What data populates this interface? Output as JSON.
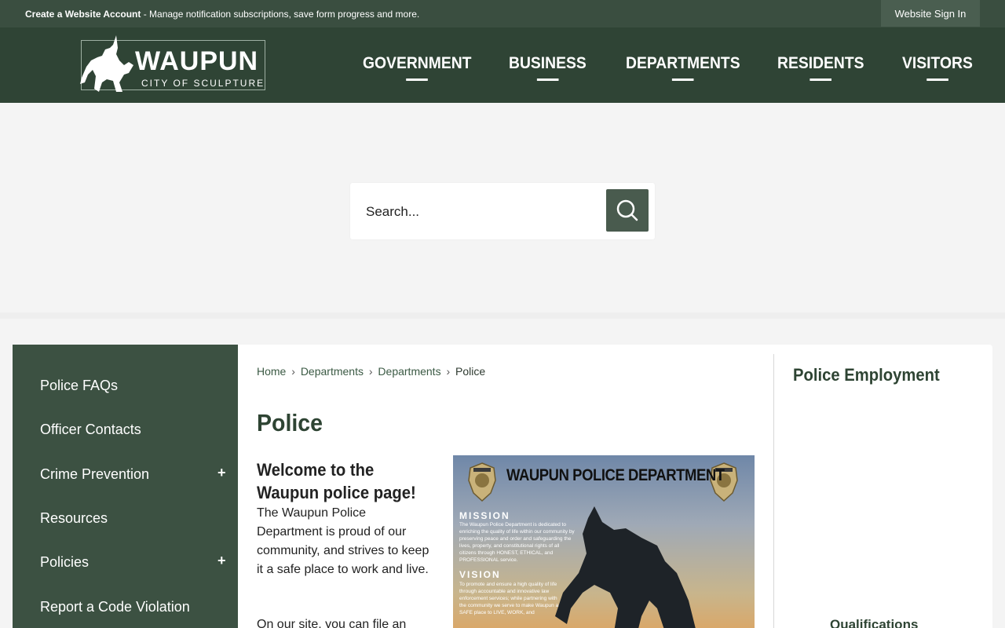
{
  "topbar": {
    "create_account": "Create a Website Account",
    "message": " - Manage notification subscriptions, save form progress and more.",
    "signin": "Website Sign In"
  },
  "logo": {
    "name": "WAUPUN",
    "tagline": "CITY OF SCULPTURE"
  },
  "nav": {
    "items": [
      "GOVERNMENT",
      "BUSINESS",
      "DEPARTMENTS",
      "RESIDENTS",
      "VISITORS"
    ]
  },
  "search": {
    "placeholder": "Search...",
    "icon": "search-icon"
  },
  "sidebar": {
    "items": [
      {
        "label": "Police FAQs"
      },
      {
        "label": "Officer Contacts"
      },
      {
        "label": "Crime Prevention",
        "expand": "+"
      },
      {
        "label": "Resources"
      },
      {
        "label": "Policies",
        "expand": "+"
      },
      {
        "label": "Report a Code Violation"
      }
    ]
  },
  "breadcrumb": {
    "items": [
      "Home",
      "Departments",
      "Departments",
      "Police"
    ],
    "separator": "›"
  },
  "main": {
    "title": "Police",
    "welcome": "Welcome to the Waupun police page!",
    "intro": "The Waupun Police Department is proud of our community, and strives to keep it a safe place to work and live.",
    "intro2": "On our site, you can file an"
  },
  "poster": {
    "title": "WAUPUN POLICE DEPARTMENT",
    "mission_heading": "MISSION",
    "mission_text": "The Waupun Police Department is dedicated to enriching the quality of life within our community by preserving peace and order and safeguarding the lives, property, and constitutional rights of all citizens through HONEST, ETHICAL, and PROFESSIONAL service.",
    "vision_heading": "VISION",
    "vision_text": "To promote and ensure a high quality of life through accountable and innovative law enforcement services; while partnering with the community we serve to make Waupun a SAFE place to LIVE, WORK, and"
  },
  "rightcol": {
    "title": "Police Employment",
    "sub": "Qualifications"
  },
  "colors": {
    "topbar": "#3a4e40",
    "header": "#2f4435",
    "sidebar": "#3c5142",
    "accent": "#495b4e"
  }
}
